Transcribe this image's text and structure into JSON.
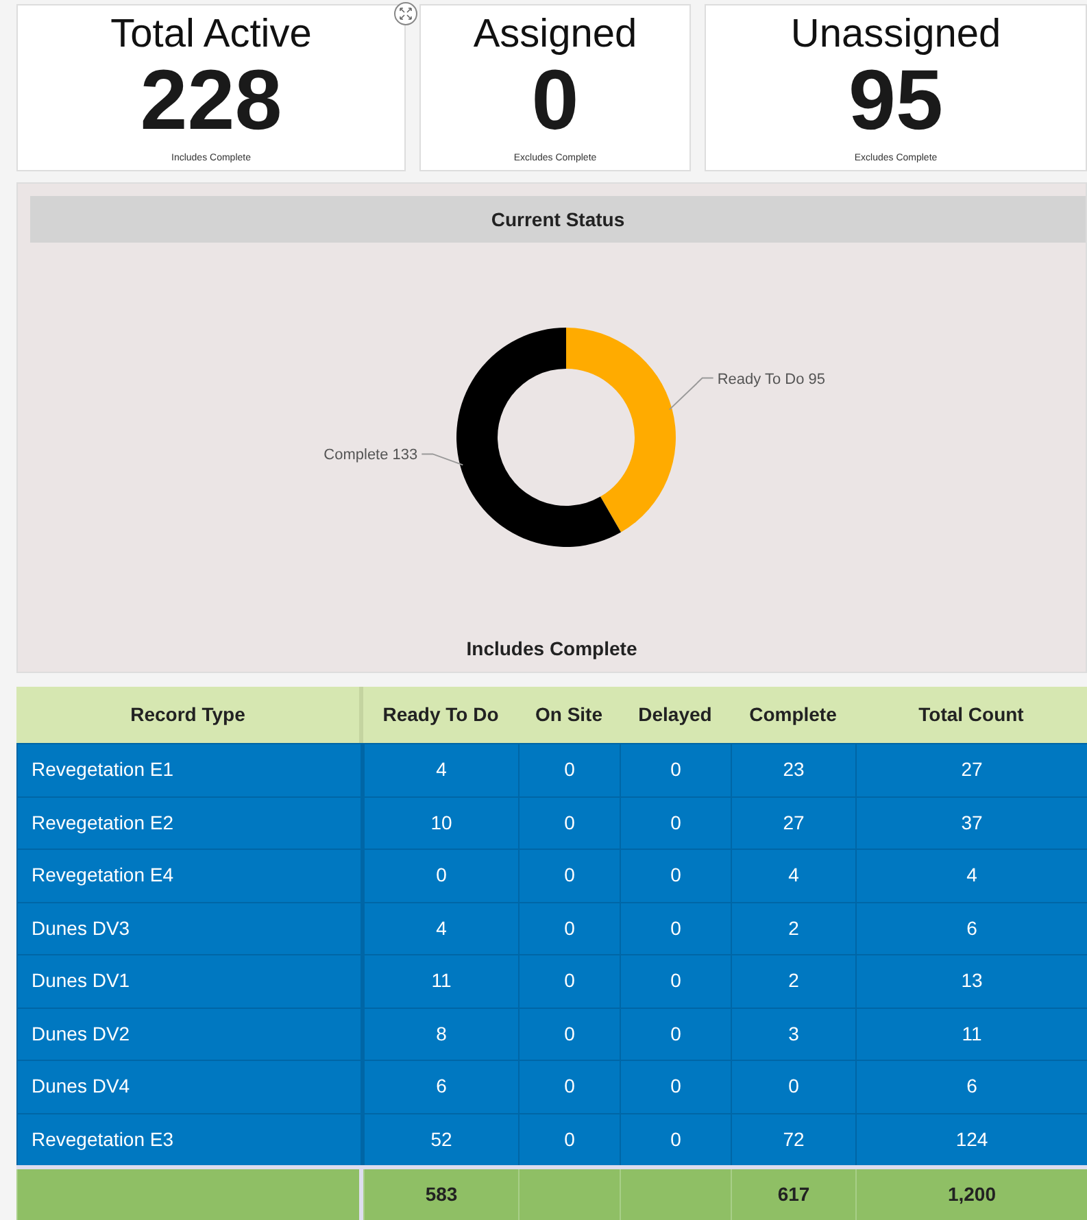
{
  "cards": [
    {
      "title": "Total Active",
      "value": "228",
      "note": "Includes Complete",
      "expand_button": true
    },
    {
      "title": "Assigned",
      "value": "0",
      "note": "Excludes Complete",
      "expand_button": false
    },
    {
      "title": "Unassigned",
      "value": "95",
      "note": "Excludes Complete",
      "expand_button": false
    }
  ],
  "status_panel": {
    "title": "Current Status",
    "footnote": "Includes Complete",
    "chart_data": {
      "type": "donut",
      "categories": [
        "Ready To Do",
        "Complete"
      ],
      "values": [
        95,
        133
      ],
      "colors": [
        "#ffab00",
        "#000000"
      ],
      "value_labels": [
        "95",
        "133"
      ]
    }
  },
  "table": {
    "columns": [
      "Record Type",
      "Ready To Do",
      "On Site",
      "Delayed",
      "Complete",
      "Total Count"
    ],
    "rows": [
      [
        "Revegetation E1",
        "4",
        "0",
        "0",
        "23",
        "27"
      ],
      [
        "Revegetation E2",
        "10",
        "0",
        "0",
        "27",
        "37"
      ],
      [
        "Revegetation E4",
        "0",
        "0",
        "0",
        "4",
        "4"
      ],
      [
        "Dunes DV3",
        "4",
        "0",
        "0",
        "2",
        "6"
      ],
      [
        "Dunes DV1",
        "11",
        "0",
        "0",
        "2",
        "13"
      ],
      [
        "Dunes DV2",
        "8",
        "0",
        "0",
        "3",
        "11"
      ],
      [
        "Dunes DV4",
        "6",
        "0",
        "0",
        "0",
        "6"
      ],
      [
        "Revegetation E3",
        "52",
        "0",
        "0",
        "72",
        "124"
      ]
    ],
    "totals": {
      "ready_to_do": "583",
      "complete": "617",
      "total_count": "1,200"
    }
  }
}
